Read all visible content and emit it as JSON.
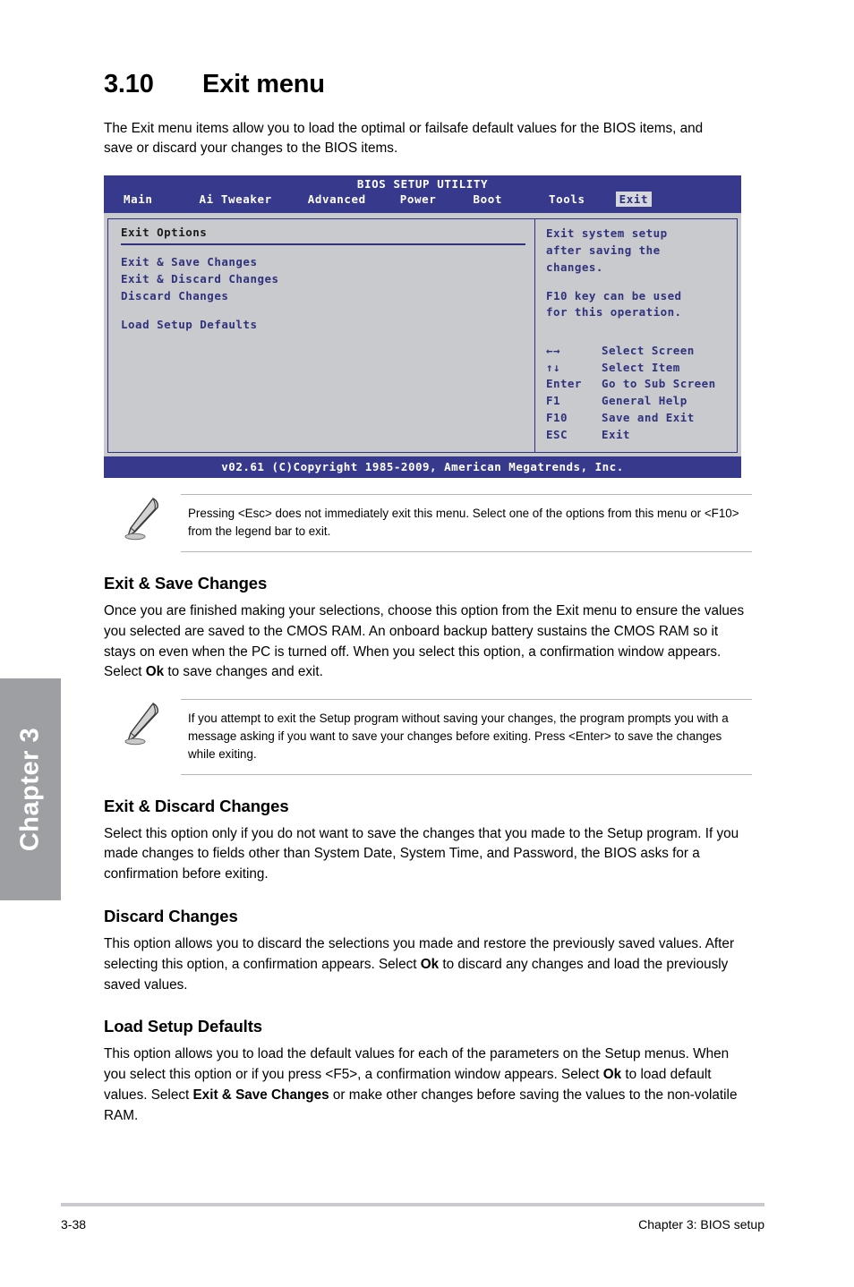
{
  "chapter_tab": {
    "label": "Chapter 3"
  },
  "heading": {
    "number": "3.10",
    "title": "Exit menu"
  },
  "intro": "The Exit menu items allow you to load the optimal or failsafe default values for the BIOS items, and save or discard your changes to the BIOS items.",
  "bios": {
    "title": "BIOS SETUP UTILITY",
    "tabs": [
      {
        "label": "Main",
        "selected": false
      },
      {
        "label": "Ai Tweaker",
        "selected": false
      },
      {
        "label": "Advanced",
        "selected": false
      },
      {
        "label": "Power",
        "selected": false
      },
      {
        "label": "Boot",
        "selected": false
      },
      {
        "label": "Tools",
        "selected": false
      },
      {
        "label": "Exit",
        "selected": true
      }
    ],
    "section_title": "Exit Options",
    "items": [
      "Exit & Save Changes",
      "Exit & Discard Changes",
      "Discard Changes",
      "Load Setup Defaults"
    ],
    "help": {
      "line1": "Exit system setup",
      "line2": "after saving the",
      "line3": "changes.",
      "line4": "F10 key can be used",
      "line5": "for this operation."
    },
    "legend": [
      {
        "key": "←→",
        "action": "Select Screen"
      },
      {
        "key": "↑↓",
        "action": "Select Item"
      },
      {
        "key": "Enter",
        "action": "Go to Sub Screen"
      },
      {
        "key": "F1",
        "action": "General Help"
      },
      {
        "key": "F10",
        "action": "Save and Exit"
      },
      {
        "key": "ESC",
        "action": "Exit"
      }
    ],
    "footer": "v02.61 (C)Copyright 1985-2009, American Megatrends, Inc."
  },
  "note1": "Pressing <Esc> does not immediately exit this menu. Select one of the options from this menu or <F10> from the legend bar to exit.",
  "section_save": {
    "title": "Exit & Save Changes",
    "text_a": "Once you are finished making your selections, choose this option from the Exit menu to ensure the values you selected are saved to the CMOS RAM. An onboard backup battery sustains the CMOS RAM so it stays on even when the PC is turned off. When you select this option, a confirmation window appears. Select ",
    "bold_ok": "Ok",
    "text_b": " to save changes and exit."
  },
  "note2": "If you attempt to exit the Setup program without saving your changes, the program prompts you with a message asking if you want to save your changes before exiting. Press <Enter> to save the changes while exiting.",
  "section_discard_exit": {
    "title": "Exit & Discard Changes",
    "text": "Select this option only if you do not want to save the changes that you made to the Setup program. If you made changes to fields other than System Date, System Time, and Password, the BIOS asks for a confirmation before exiting."
  },
  "section_discard": {
    "title": "Discard Changes",
    "text_a": "This option allows you to discard the selections you made and restore the previously saved values. After selecting this option, a confirmation appears. Select ",
    "bold_ok": "Ok",
    "text_b": " to discard any changes and load the previously saved values."
  },
  "section_defaults": {
    "title": "Load Setup Defaults",
    "text_a": "This option allows you to load the default values for each of the parameters on the Setup menus. When you select this option or if you press <F5>, a confirmation window appears. Select ",
    "bold_ok": "Ok",
    "text_b": " to load default values. Select ",
    "bold_exit_save": "Exit & Save Changes",
    "text_c": " or make other changes before saving the values to the non-volatile RAM."
  },
  "footer": {
    "page_number": "3-38",
    "chapter": "Chapter 3: BIOS setup"
  },
  "colors": {
    "bios_header_blue": "#373a8c",
    "bios_panel_gray": "#c9cacd",
    "bios_text_blue": "#30327e",
    "chapter_tab_gray": "#9d9fa2"
  }
}
